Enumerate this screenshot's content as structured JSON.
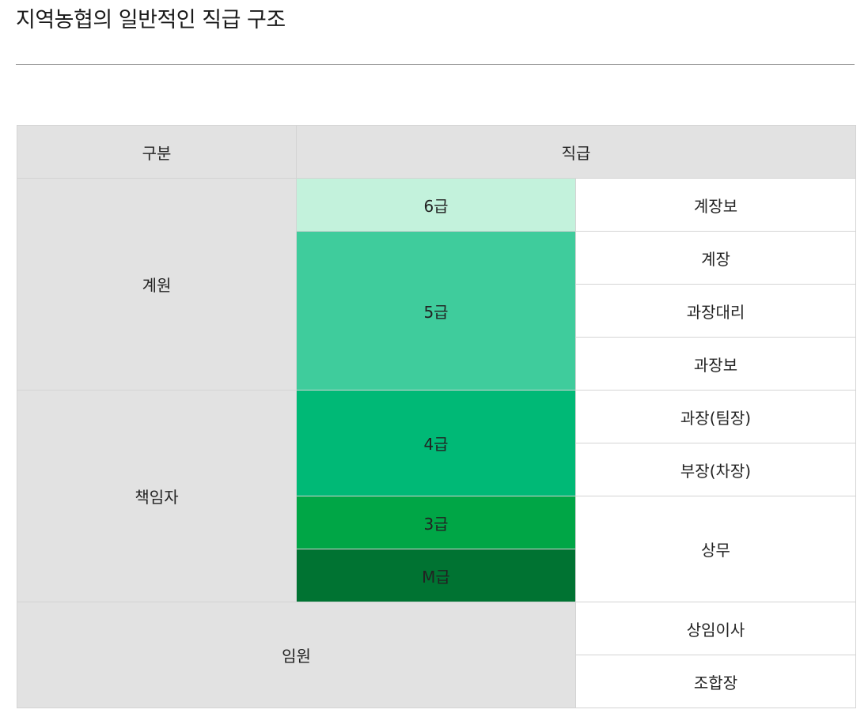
{
  "page": {
    "title": "지역농협의 일반적인 직급 구조"
  },
  "table": {
    "header": {
      "category": "구분",
      "rank": "직급"
    },
    "categories": {
      "gyewon": "계원",
      "chaegimja": "책임자",
      "imwon": "임원"
    },
    "grades": {
      "g6": {
        "label": "6급",
        "color": "#c3f2dc"
      },
      "g5": {
        "label": "5급",
        "color": "#3fcc9c"
      },
      "g4": {
        "label": "4급",
        "color": "#00b976"
      },
      "g3": {
        "label": "3급",
        "color": "#00a646"
      },
      "gm": {
        "label": "M급",
        "color": "#007332"
      }
    },
    "positions": [
      "계장보",
      "계장",
      "과장대리",
      "과장보",
      "과장(팀장)",
      "부장(차장)",
      "상무",
      "상임이사",
      "조합장"
    ]
  }
}
